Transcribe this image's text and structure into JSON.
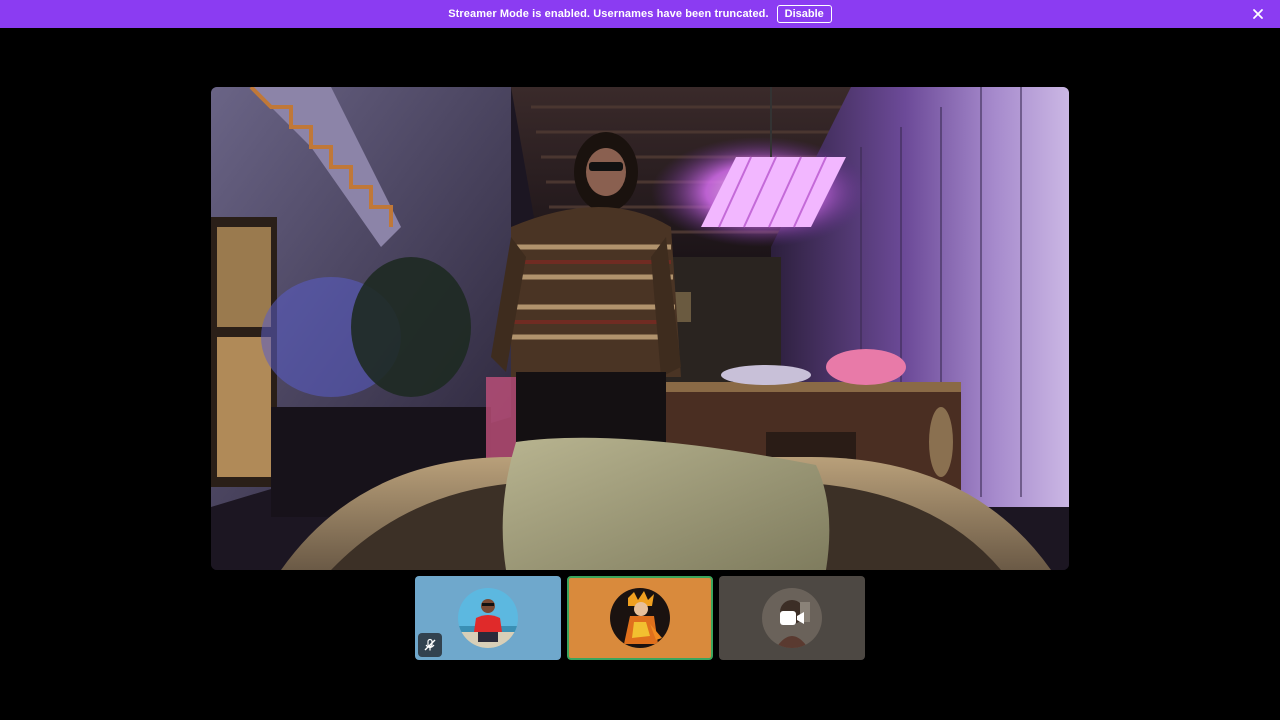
{
  "banner": {
    "message": "Streamer Mode is enabled. Usernames have been truncated.",
    "disable_label": "Disable",
    "close_icon": "close-icon",
    "background": "#8b3cf2"
  },
  "stage": {
    "kind": "main-video-feed",
    "content": "webcam-video"
  },
  "participants": [
    {
      "avatar_color": "#6fa8cc",
      "muted": true,
      "mute_icon": "mic-muted-icon",
      "active_speaker": false
    },
    {
      "avatar_color": "#d98a3c",
      "muted": false,
      "active_speaker": true,
      "speaker_ring_color": "#3ba55d"
    },
    {
      "avatar_color": "#4d4843",
      "muted": false,
      "active_speaker": false,
      "overlay_icon": "video-camera-icon"
    }
  ]
}
